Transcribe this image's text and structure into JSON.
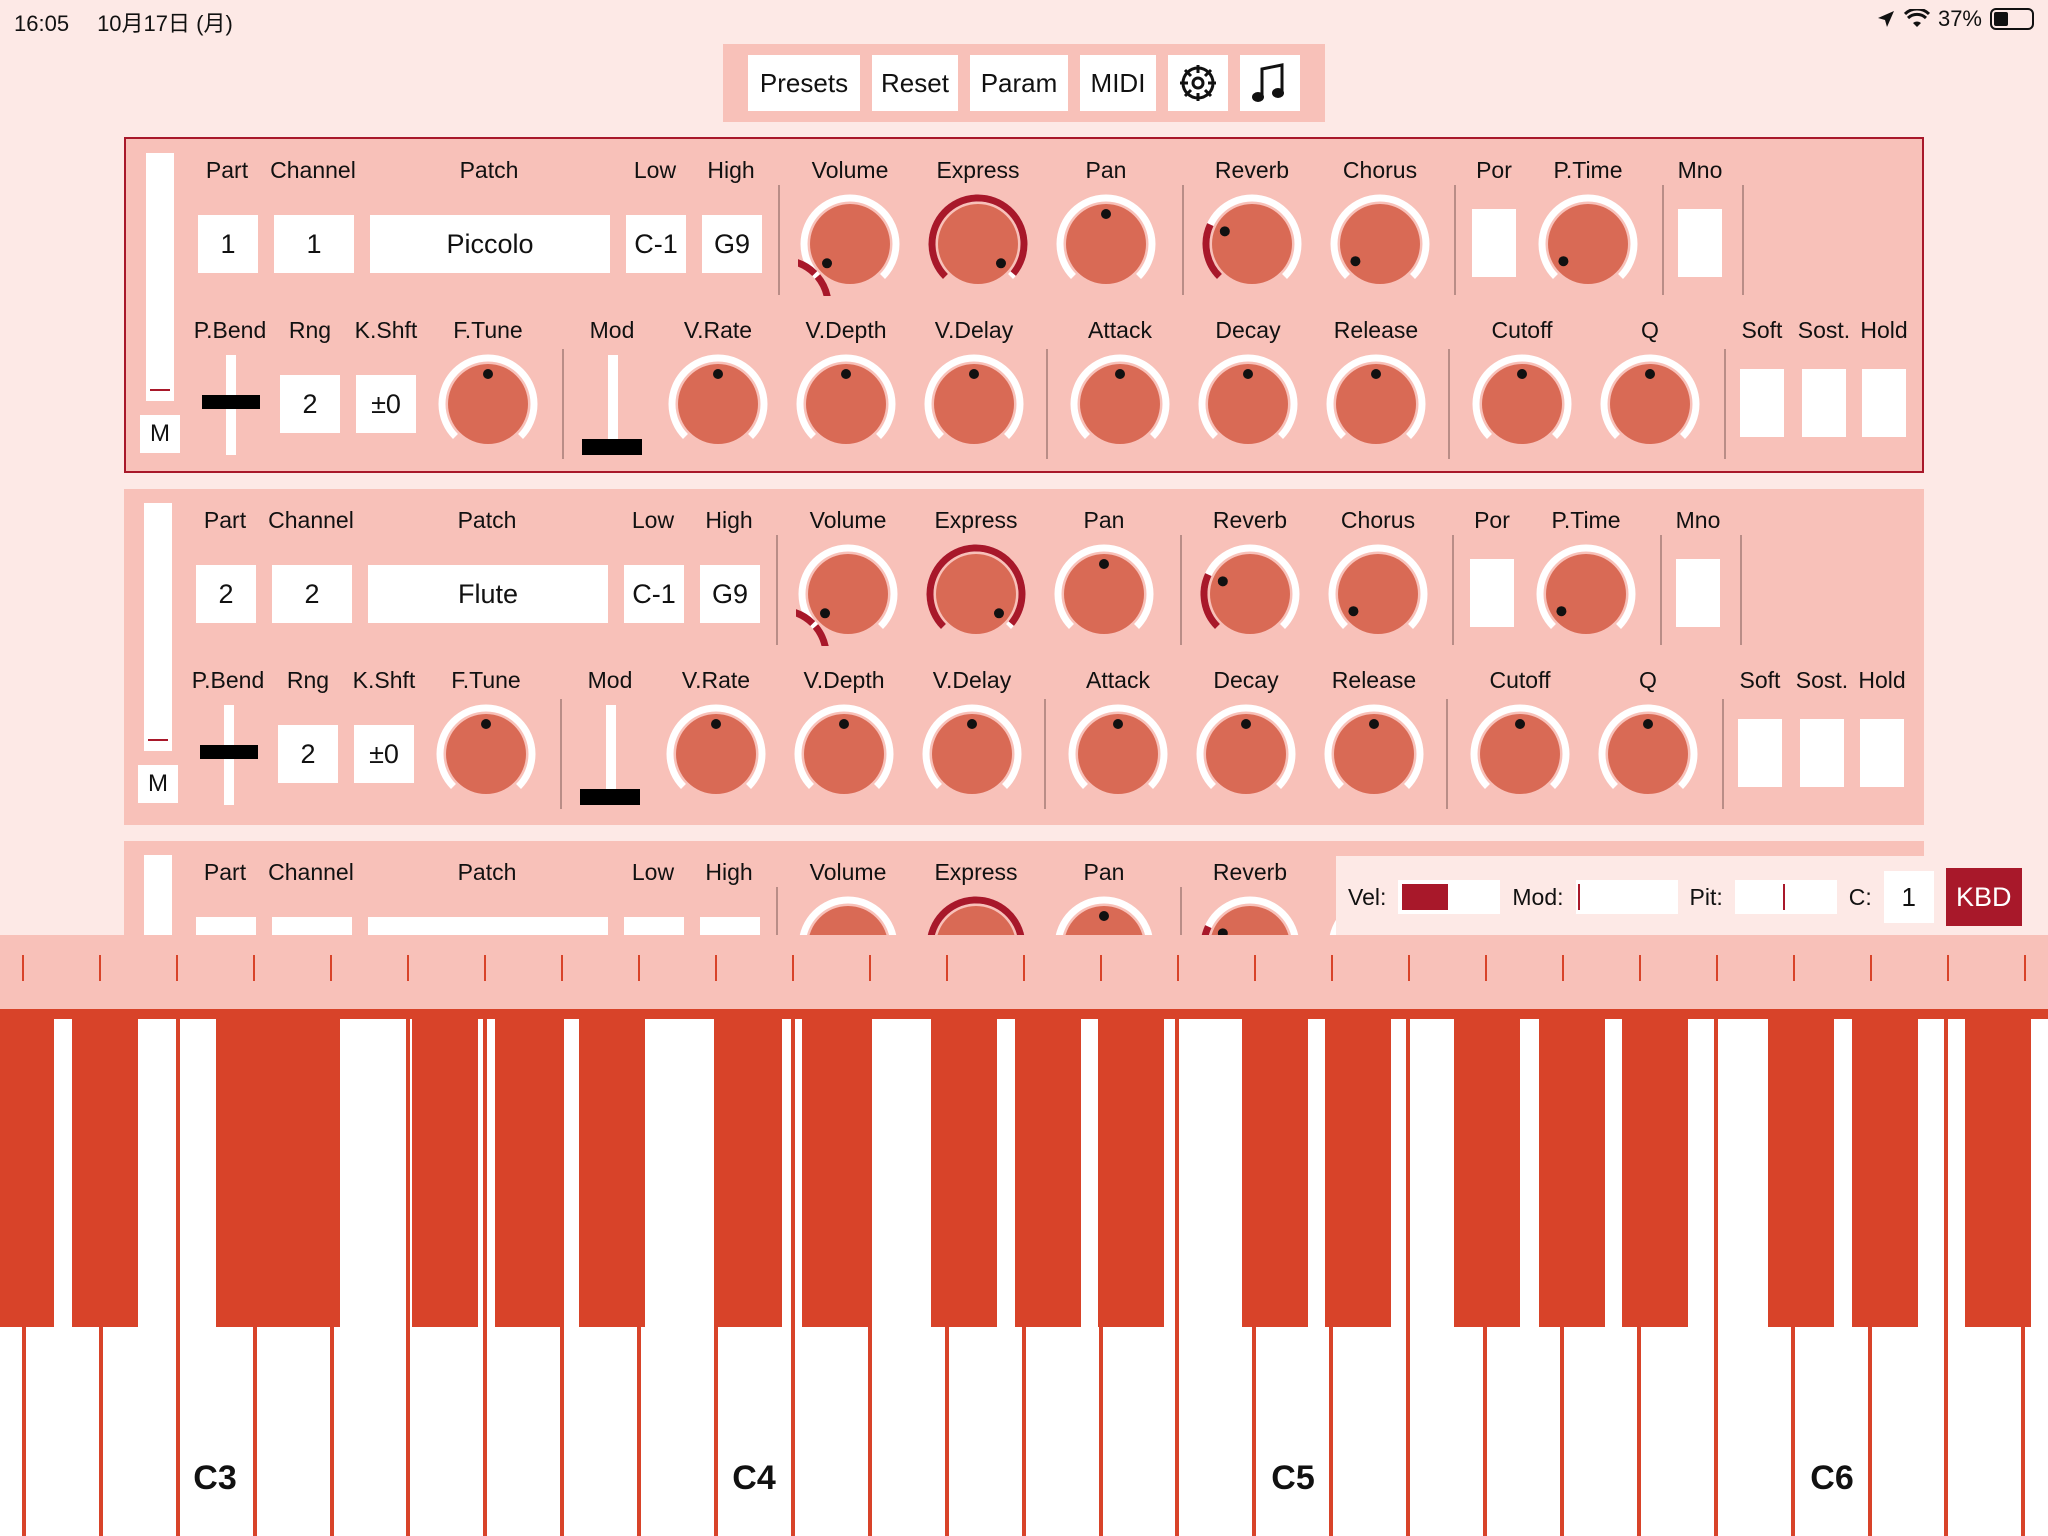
{
  "status": {
    "time": "16:05",
    "date": "10月17日 (月)",
    "battery": "37%"
  },
  "toolbar": {
    "presets": "Presets",
    "reset": "Reset",
    "param": "Param",
    "midi": "MIDI",
    "settings_icon": "gear-icon",
    "music_icon": "music-note-icon"
  },
  "labels": {
    "part": "Part",
    "channel": "Channel",
    "patch": "Patch",
    "low": "Low",
    "high": "High",
    "volume": "Volume",
    "express": "Express",
    "pan": "Pan",
    "reverb": "Reverb",
    "chorus": "Chorus",
    "por": "Por",
    "ptime": "P.Time",
    "mno": "Mno",
    "pbend": "P.Bend",
    "rng": "Rng",
    "kshft": "K.Shft",
    "ftune": "F.Tune",
    "mod": "Mod",
    "vrate": "V.Rate",
    "vdepth": "V.Depth",
    "vdelay": "V.Delay",
    "attack": "Attack",
    "decay": "Decay",
    "release": "Release",
    "cutoff": "Cutoff",
    "q": "Q",
    "soft": "Soft",
    "sost": "Sost.",
    "hold": "Hold",
    "m": "M"
  },
  "parts": [
    {
      "part": "1",
      "channel": "1",
      "patch": "Piccolo",
      "low": "C-1",
      "high": "G9",
      "rng": "2",
      "kshft": "±0"
    },
    {
      "part": "2",
      "channel": "2",
      "patch": "Flute",
      "low": "C-1",
      "high": "G9",
      "rng": "2",
      "kshft": "±0"
    },
    {
      "part": "",
      "channel": "",
      "patch": "",
      "low": "",
      "high": "",
      "rng": "",
      "kshft": ""
    }
  ],
  "control_bar": {
    "vel_label": "Vel:",
    "mod_label": "Mod:",
    "pit_label": "Pit:",
    "c_label": "C:",
    "channel": "1",
    "kbd": "KBD"
  },
  "keyboard": {
    "octave_labels": [
      "C3",
      "C4",
      "C5",
      "C6"
    ]
  },
  "colors": {
    "accent": "#a8182a",
    "key_red": "#d84329",
    "knob": "#d96a55",
    "panel": "#f8c1b9",
    "background": "#fde9e6"
  }
}
